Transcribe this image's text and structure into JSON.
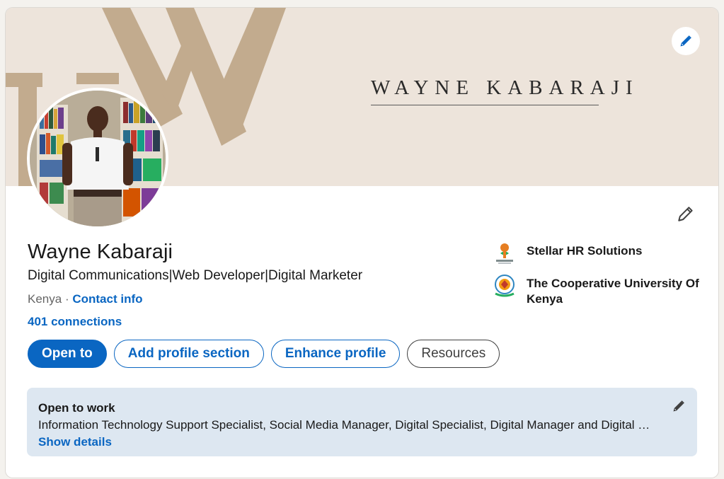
{
  "banner": {
    "title": "WAYNE KABARAJI",
    "colors": {
      "background": "#ede4db",
      "monogram": "#c2ab8e"
    }
  },
  "profile": {
    "name": "Wayne Kabaraji",
    "headline": "Digital Communications|Web Developer|Digital Marketer",
    "location": "Kenya",
    "separator": "·",
    "contact_info_label": "Contact info",
    "connections_label": "401 connections"
  },
  "actions": {
    "open_to": "Open to",
    "add_profile_section": "Add profile section",
    "enhance_profile": "Enhance profile",
    "resources": "Resources"
  },
  "organizations": [
    {
      "name": "Stellar HR Solutions",
      "logo": "stellar-hr-logo"
    },
    {
      "name": "The Cooperative University Of Kenya",
      "logo": "cooperative-university-crest"
    }
  ],
  "open_to_work": {
    "title": "Open to work",
    "description": "Information Technology Support Specialist, Social Media Manager, Digital Specialist, Digital Manager and Digital …",
    "show_details_label": "Show details"
  },
  "icons": {
    "banner_edit": "pencil-icon",
    "intro_edit": "pencil-icon",
    "open_to_work_edit": "pencil-icon"
  },
  "colors": {
    "accent": "#0a66c2",
    "text": "#191919",
    "muted": "#666666",
    "open_to_work_bg": "#dde7f1"
  }
}
